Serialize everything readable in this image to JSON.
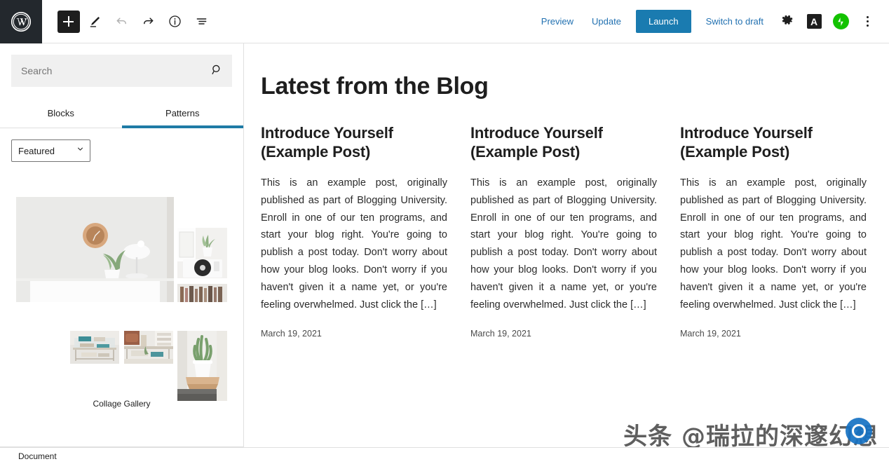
{
  "app": {
    "logo_icon": "wordpress-logo-icon"
  },
  "toolbar": {
    "add_block_label": "+",
    "tools": [
      {
        "name": "add-block-button",
        "icon": "plus-icon",
        "label": "Add block"
      },
      {
        "name": "edit-tool-button",
        "icon": "pencil-icon",
        "label": "Tools"
      },
      {
        "name": "undo-button",
        "icon": "undo-icon",
        "label": "Undo"
      },
      {
        "name": "redo-button",
        "icon": "redo-icon",
        "label": "Redo"
      },
      {
        "name": "details-button",
        "icon": "info-icon",
        "label": "Details"
      },
      {
        "name": "list-view-button",
        "icon": "list-view-icon",
        "label": "List view"
      }
    ],
    "preview_label": "Preview",
    "update_label": "Update",
    "launch_label": "Launch",
    "switch_to_draft_label": "Switch to draft",
    "settings_icon": "gear-icon",
    "akismet_icon": "a-badge-icon",
    "akismet_letter": "A",
    "jetpack_icon": "jetpack-icon",
    "more_menu_icon": "three-dots-vertical-icon",
    "launch_color": "#1a7bb0",
    "link_color": "#2271b1"
  },
  "sidebar": {
    "search": {
      "placeholder": "Search",
      "value": "",
      "icon": "search-icon"
    },
    "tabs": [
      {
        "label": "Blocks",
        "active": false
      },
      {
        "label": "Patterns",
        "active": true
      }
    ],
    "active_tab_color": "#1e7ba6",
    "category_select": {
      "selected": "Featured",
      "icon": "chevron-down-icon",
      "options": [
        "Featured"
      ]
    },
    "pattern": {
      "caption": "Collage Gallery",
      "images": [
        {
          "name": "gallery-image-clock-lamp-plant",
          "alt": "White wall with wooden clock, lamp and potted plant"
        },
        {
          "name": "gallery-image-record-player",
          "alt": "Record player with plant on shelf"
        },
        {
          "name": "gallery-image-coffee-table-books",
          "alt": "Glass coffee table with books"
        },
        {
          "name": "gallery-image-living-room",
          "alt": "Living room with leather sofa and table"
        },
        {
          "name": "gallery-image-wall-shelf-plant",
          "alt": "Aloe plant on a wooden wall shelf"
        }
      ]
    }
  },
  "canvas": {
    "blog_heading": "Latest from the Blog",
    "posts": [
      {
        "title": "Introduce Yourself (Example Post)",
        "excerpt": "This is an example post, originally published as part of Blogging University. Enroll in one of our ten programs, and start your blog right. You're going to publish a post today. Don't worry about how your blog looks. Don't worry if you haven't given it a name yet, or you're feeling overwhelmed. Just click the […]",
        "date": "March 19, 2021"
      },
      {
        "title": "Introduce Yourself (Example Post)",
        "excerpt": "This is an example post, originally published as part of Blogging University. Enroll in one of our ten programs, and start your blog right. You're going to publish a post today. Don't worry about how your blog looks. Don't worry if you haven't given it a name yet, or you're feeling overwhelmed. Just click the […]",
        "date": "March 19, 2021"
      },
      {
        "title": "Introduce Yourself (Example Post)",
        "excerpt": "This is an example post, originally published as part of Blogging University. Enroll in one of our ten programs, and start your blog right. You're going to publish a post today. Don't worry about how your blog looks. Don't worry if you haven't given it a name yet, or you're feeling overwhelmed. Just click the […]",
        "date": "March 19, 2021"
      }
    ]
  },
  "statusbar": {
    "document_label": "Document"
  },
  "watermark": {
    "text": "头条 @瑞拉的深邃幻想",
    "badge_color": "#1672c4"
  }
}
